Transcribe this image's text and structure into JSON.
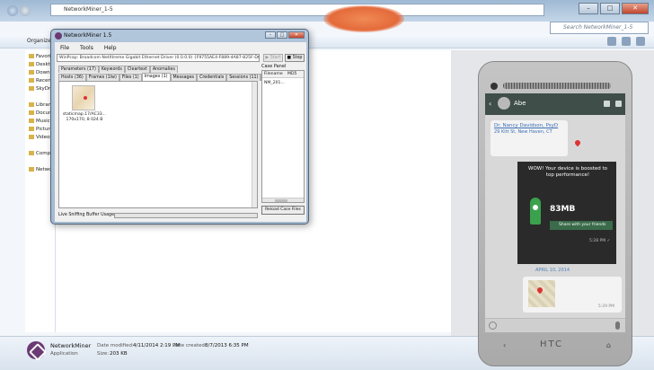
{
  "explorer": {
    "title": "NetworkMiner_1-5",
    "search_placeholder": "Search NetworkMiner_1-5",
    "organize_label": "Organize ▾",
    "nav_items": [
      "Favorites",
      "Desktop",
      "Downloads",
      "Recent",
      "SkyDrive",
      "Libraries",
      "Documents",
      "Music",
      "Pictures",
      "Videos",
      "Computer",
      "Network"
    ],
    "details": {
      "name": "NetworkMiner",
      "type": "Application",
      "modified_label": "Date modified:",
      "modified_value": "4/11/2014 2:19 PM",
      "size_label": "Size:",
      "size_value": "203 KB",
      "created_label": "Date created:",
      "created_value": "8/7/2013 6:35 PM"
    }
  },
  "networkminer": {
    "title": "NetworkMiner 1.5",
    "menu": [
      "File",
      "Tools",
      "Help"
    ],
    "adapter": "WinPcap: Broadcom NetXtreme Gigabit Ethernet Driver (0.0.0.0) {F9755AE4-F889-4A87-825F-D64A569",
    "start_label": "▶ Start",
    "stop_label": "■ Stop",
    "tabs_row1": [
      "Parameters (17)",
      "Keywords",
      "Cleartext",
      "Anomalies"
    ],
    "tabs_row2": [
      "Hosts (36)",
      "Frames (1lw)",
      "Files (1)",
      "Images (1)",
      "Messages",
      "Credentials",
      "Sessions (11)",
      "DNS"
    ],
    "active_tab": "Images (1)",
    "image": {
      "name": "staticmap.17/AC33...",
      "info": "170x170, 8 024 B"
    },
    "case_panel": {
      "title": "Case Panel",
      "col_filename": "Filename",
      "col_md5": "MD5",
      "row_filename": "NM_201...",
      "reload_label": "Reload Case Files"
    },
    "buffer_label": "Live Sniffing Buffer Usage:",
    "buffer_usage": 0.0
  },
  "phone": {
    "chat_name": "Abe",
    "map_title": "Dr. Nancy Davidson, PsyD",
    "map_address": "29 Kitt St, New Haven, CT",
    "ad_text": "WOW! Your device is boosted to top performance!",
    "ad_value": "83MB",
    "share_label": "Share with your friends",
    "ad_time": "5:28 PM ✓",
    "date_chip": "APRIL 10, 2014",
    "map_time": "5:29 PM",
    "brand": "HTC",
    "nav_back": "‹",
    "nav_home": "⌂"
  },
  "colors": {
    "accent": "#6b3a73",
    "chat_bar": "#3f4e48",
    "buffer_fill": "#5ec65e"
  }
}
